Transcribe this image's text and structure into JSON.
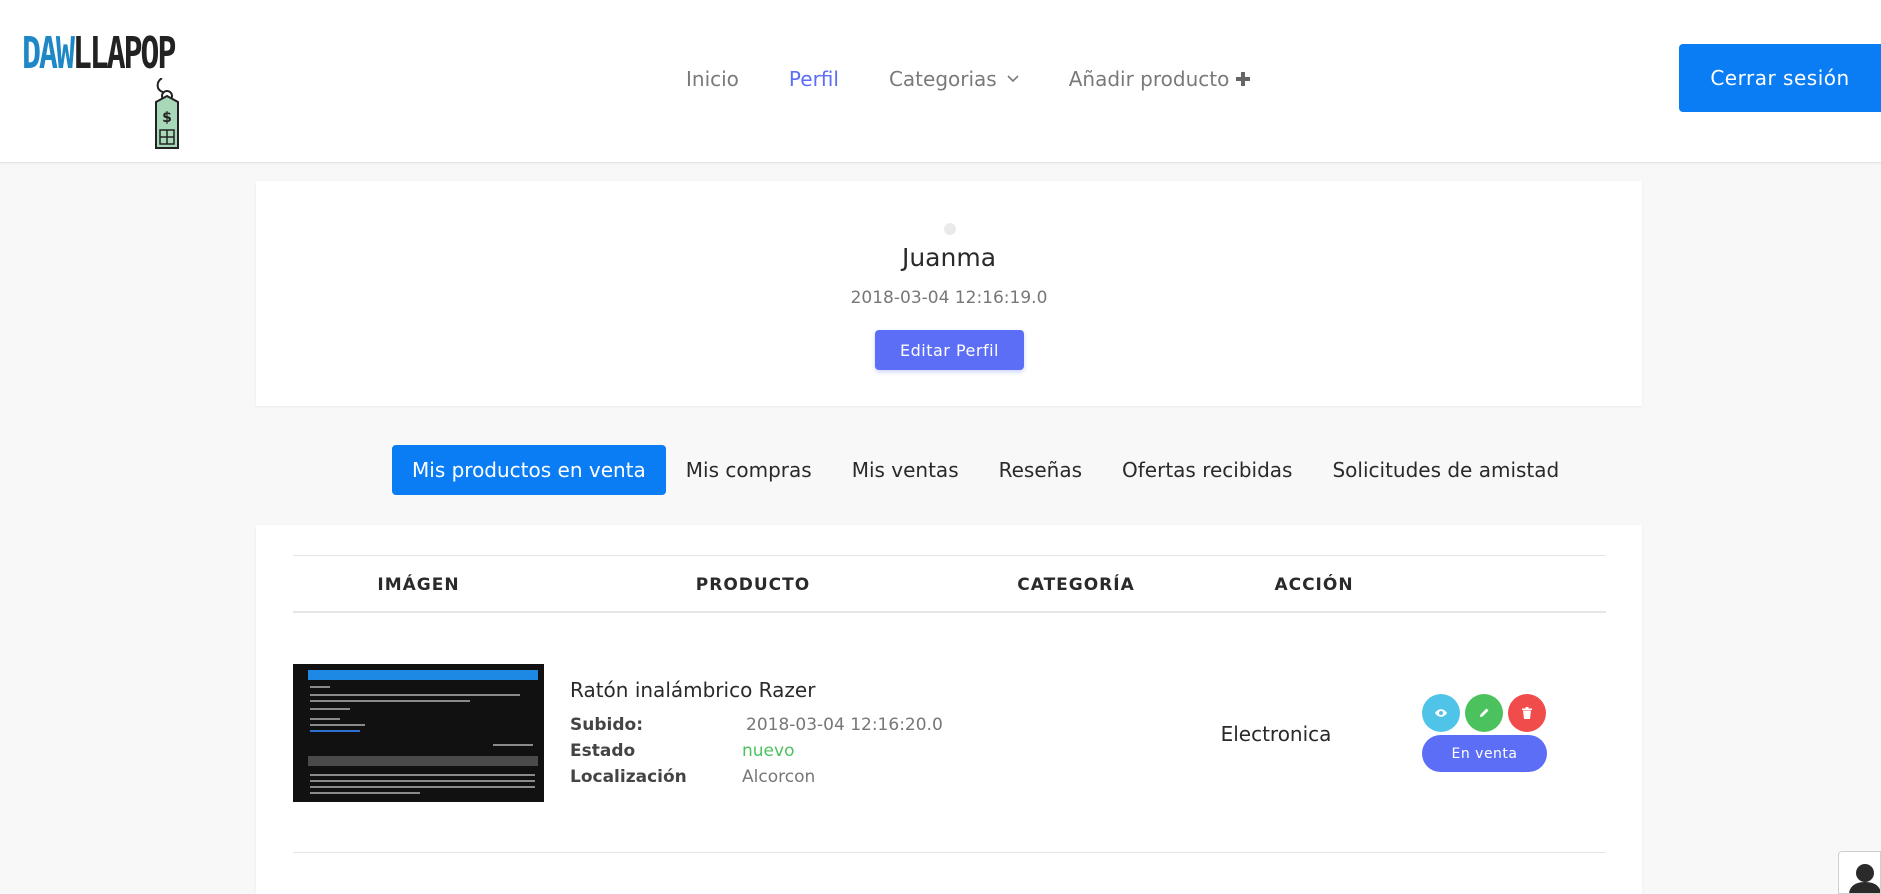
{
  "brand": {
    "logo_part1": "DAW",
    "logo_part2": "LLAPOP"
  },
  "nav": {
    "items": [
      {
        "label": "Inicio"
      },
      {
        "label": "Perfil"
      },
      {
        "label": "Categorias"
      },
      {
        "label": "Añadir producto"
      }
    ],
    "active": "Perfil",
    "logout_label": "Cerrar sesión"
  },
  "profile": {
    "name": "Juanma",
    "date": "2018-03-04 12:16:19.0",
    "edit_label": "Editar Perfil"
  },
  "tabs": {
    "items": [
      {
        "label": "Mis productos en venta"
      },
      {
        "label": "Mis compras"
      },
      {
        "label": "Mis ventas"
      },
      {
        "label": "Reseñas"
      },
      {
        "label": "Ofertas recibidas"
      },
      {
        "label": "Solicitudes de amistad"
      }
    ],
    "active": "Mis productos en venta"
  },
  "table": {
    "headers": {
      "image": "IMÁGEN",
      "product": "PRODUCTO",
      "category": "CATEGORÍA",
      "action": "ACCIÓN"
    },
    "rows": [
      {
        "name": "Ratón inalámbrico Razer",
        "uploaded_label": "Subido:",
        "uploaded": "2018-03-04 12:16:20.0",
        "state_label": "Estado",
        "state": "nuevo",
        "location_label": "Localización",
        "location": "Alcorcon",
        "category": "Electronica",
        "status_label": "En venta"
      }
    ]
  },
  "colors": {
    "primary": "#0a7df5",
    "accent": "#5b6ef5",
    "view": "#4fc3e8",
    "edit": "#4cc25e",
    "delete": "#f04c4c",
    "state_new": "#4cc25e"
  },
  "icons": {
    "view": "eye-icon",
    "edit": "pencil-icon",
    "delete": "trash-icon",
    "dropdown": "chevron-down-icon",
    "add": "plus-icon",
    "user": "user-icon"
  }
}
